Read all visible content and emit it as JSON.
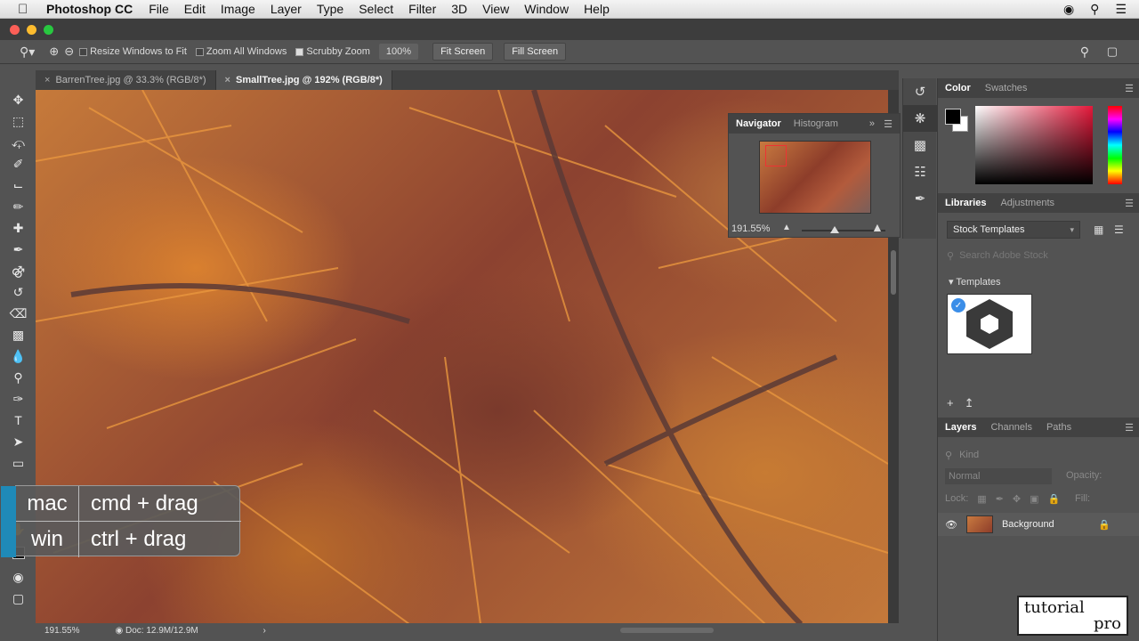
{
  "menubar": {
    "app": "Photoshop CC",
    "items": [
      "File",
      "Edit",
      "Image",
      "Layer",
      "Type",
      "Select",
      "Filter",
      "3D",
      "View",
      "Window",
      "Help"
    ]
  },
  "options": {
    "resize_windows": "Resize Windows to Fit",
    "zoom_all": "Zoom All Windows",
    "scrubby": "Scrubby Zoom",
    "zoom_pct": "100%",
    "fit_screen": "Fit Screen",
    "fill_screen": "Fill Screen"
  },
  "tabs": [
    {
      "label": "BarrenTree.jpg @ 33.3% (RGB/8*)",
      "active": false
    },
    {
      "label": "SmallTree.jpg @ 192% (RGB/8*)",
      "active": true
    }
  ],
  "navigator": {
    "tab1": "Navigator",
    "tab2": "Histogram",
    "zoom": "191.55%"
  },
  "color_panel": {
    "tab1": "Color",
    "tab2": "Swatches",
    "hue_color": "#e4183a"
  },
  "libraries": {
    "tab1": "Libraries",
    "tab2": "Adjustments",
    "selected": "Stock Templates",
    "search_placeholder": "Search Adobe Stock",
    "section": "Templates"
  },
  "layers": {
    "tab1": "Layers",
    "tab2": "Channels",
    "tab3": "Paths",
    "kind": "Kind",
    "blend": "Normal",
    "opacity_label": "Opacity:",
    "lock_label": "Lock:",
    "fill_label": "Fill:",
    "layer_name": "Background"
  },
  "status": {
    "zoom": "191.55%",
    "doc": "Doc: 12.9M/12.9M"
  },
  "overlay": {
    "mac_key": "mac",
    "mac_action": "cmd + drag",
    "win_key": "win",
    "win_action": "ctrl + drag"
  },
  "logo": {
    "line1": "tutorial",
    "line2": "pro"
  }
}
